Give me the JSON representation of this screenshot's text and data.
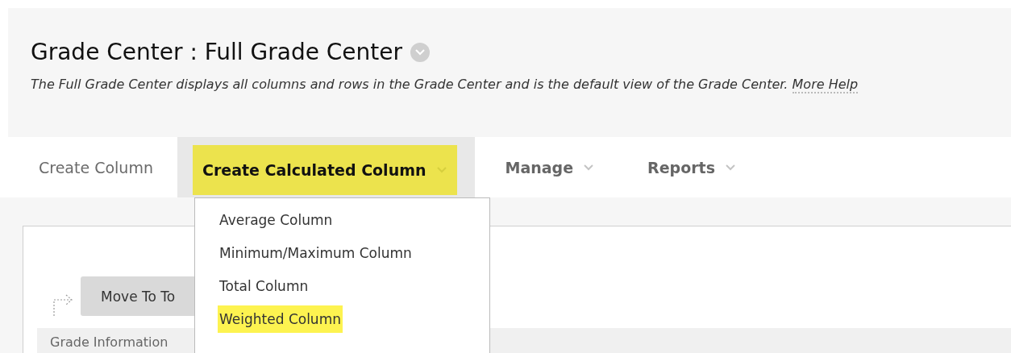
{
  "header": {
    "title": "Grade Center : Full Grade Center",
    "description": "The Full Grade Center displays all columns and rows in the Grade Center and is the default view of the Grade Center.",
    "help_link": "More Help"
  },
  "nav_tabs": [
    {
      "label": "Create Column",
      "kind": "link",
      "selected": false
    },
    {
      "label": "Create Calculated Column",
      "kind": "menu",
      "selected": true
    },
    {
      "label": "Manage",
      "kind": "menu",
      "selected": false
    },
    {
      "label": "Reports",
      "kind": "menu",
      "selected": false
    }
  ],
  "dropdown_menu": [
    {
      "label": "Average Column",
      "selected": false
    },
    {
      "label": "Minimum/Maximum Column",
      "selected": false
    },
    {
      "label": "Total Column",
      "selected": false
    },
    {
      "label": "Weighted Column",
      "selected": true
    }
  ],
  "content": {
    "move_button": "Move To To",
    "info_bar": "Grade Information"
  }
}
